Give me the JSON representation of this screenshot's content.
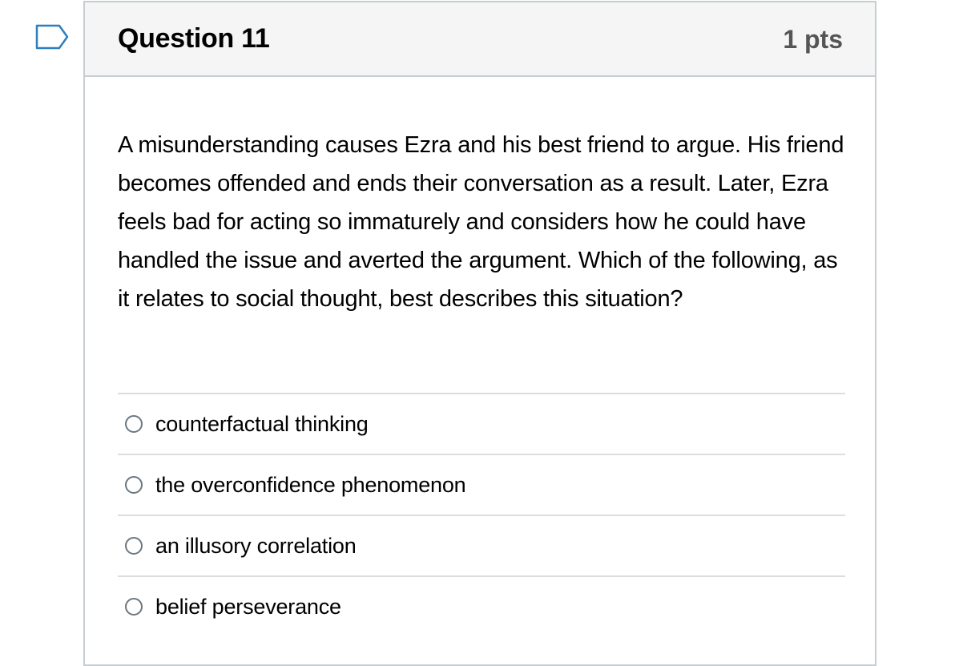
{
  "question": {
    "title": "Question 11",
    "points": "1 pts",
    "text": "A misunderstanding causes Ezra and his best friend to argue. His friend becomes offended and ends their conversation as a result. Later, Ezra feels bad for acting so immaturely and considers how he could have handled the issue and averted the argument. Which of the following, as it relates to social thought, best describes this situation?",
    "answers": [
      {
        "label": "counterfactual thinking",
        "selected": false
      },
      {
        "label": "the overconfidence phenomenon",
        "selected": false
      },
      {
        "label": "an illusory correlation",
        "selected": false
      },
      {
        "label": "belief perseverance",
        "selected": false
      }
    ]
  },
  "flag": {
    "icon": "bookmark-flag-icon",
    "color": "#2d7fc1"
  }
}
